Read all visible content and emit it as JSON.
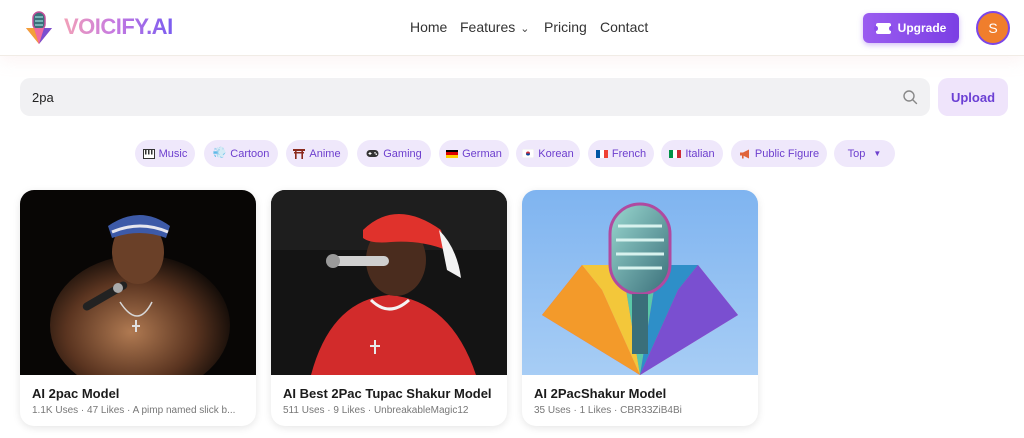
{
  "header": {
    "brand": "VOICIFY.AI",
    "nav": [
      {
        "label": "Home"
      },
      {
        "label": "Features",
        "has_dropdown": true
      },
      {
        "label": "Pricing"
      },
      {
        "label": "Contact"
      }
    ],
    "upgrade_label": "Upgrade",
    "avatar_initial": "S",
    "colors": {
      "accent": "#7b3fe4",
      "avatar": "#f07e2c"
    }
  },
  "search": {
    "value": "2pa",
    "icon": "search-icon",
    "upload_label": "Upload"
  },
  "filters": [
    {
      "label": "Music",
      "icon": "piano-icon"
    },
    {
      "label": "Cartoon",
      "icon": "cartoon-icon"
    },
    {
      "label": "Anime",
      "icon": "torii-icon"
    },
    {
      "label": "Gaming",
      "icon": "gamepad-icon"
    },
    {
      "label": "German",
      "icon": "german-flag-icon"
    },
    {
      "label": "Korean",
      "icon": "korean-flag-icon"
    },
    {
      "label": "French",
      "icon": "french-flag-icon"
    },
    {
      "label": "Italian",
      "icon": "italian-flag-icon"
    },
    {
      "label": "Public Figure",
      "icon": "megaphone-icon"
    },
    {
      "label": "Top",
      "icon": "caret-down-icon"
    }
  ],
  "results": [
    {
      "title": "AI 2pac Model",
      "meta": "1.1K Uses · 47 Likes · A pimp named slick b..."
    },
    {
      "title": "AI Best 2Pac Tupac Shakur Model",
      "meta": "511 Uses · 9 Likes · UnbreakableMagic12"
    },
    {
      "title": "AI 2PacShakur Model",
      "meta": "35 Uses · 1 Likes · CBR33ZiB4Bi"
    }
  ]
}
